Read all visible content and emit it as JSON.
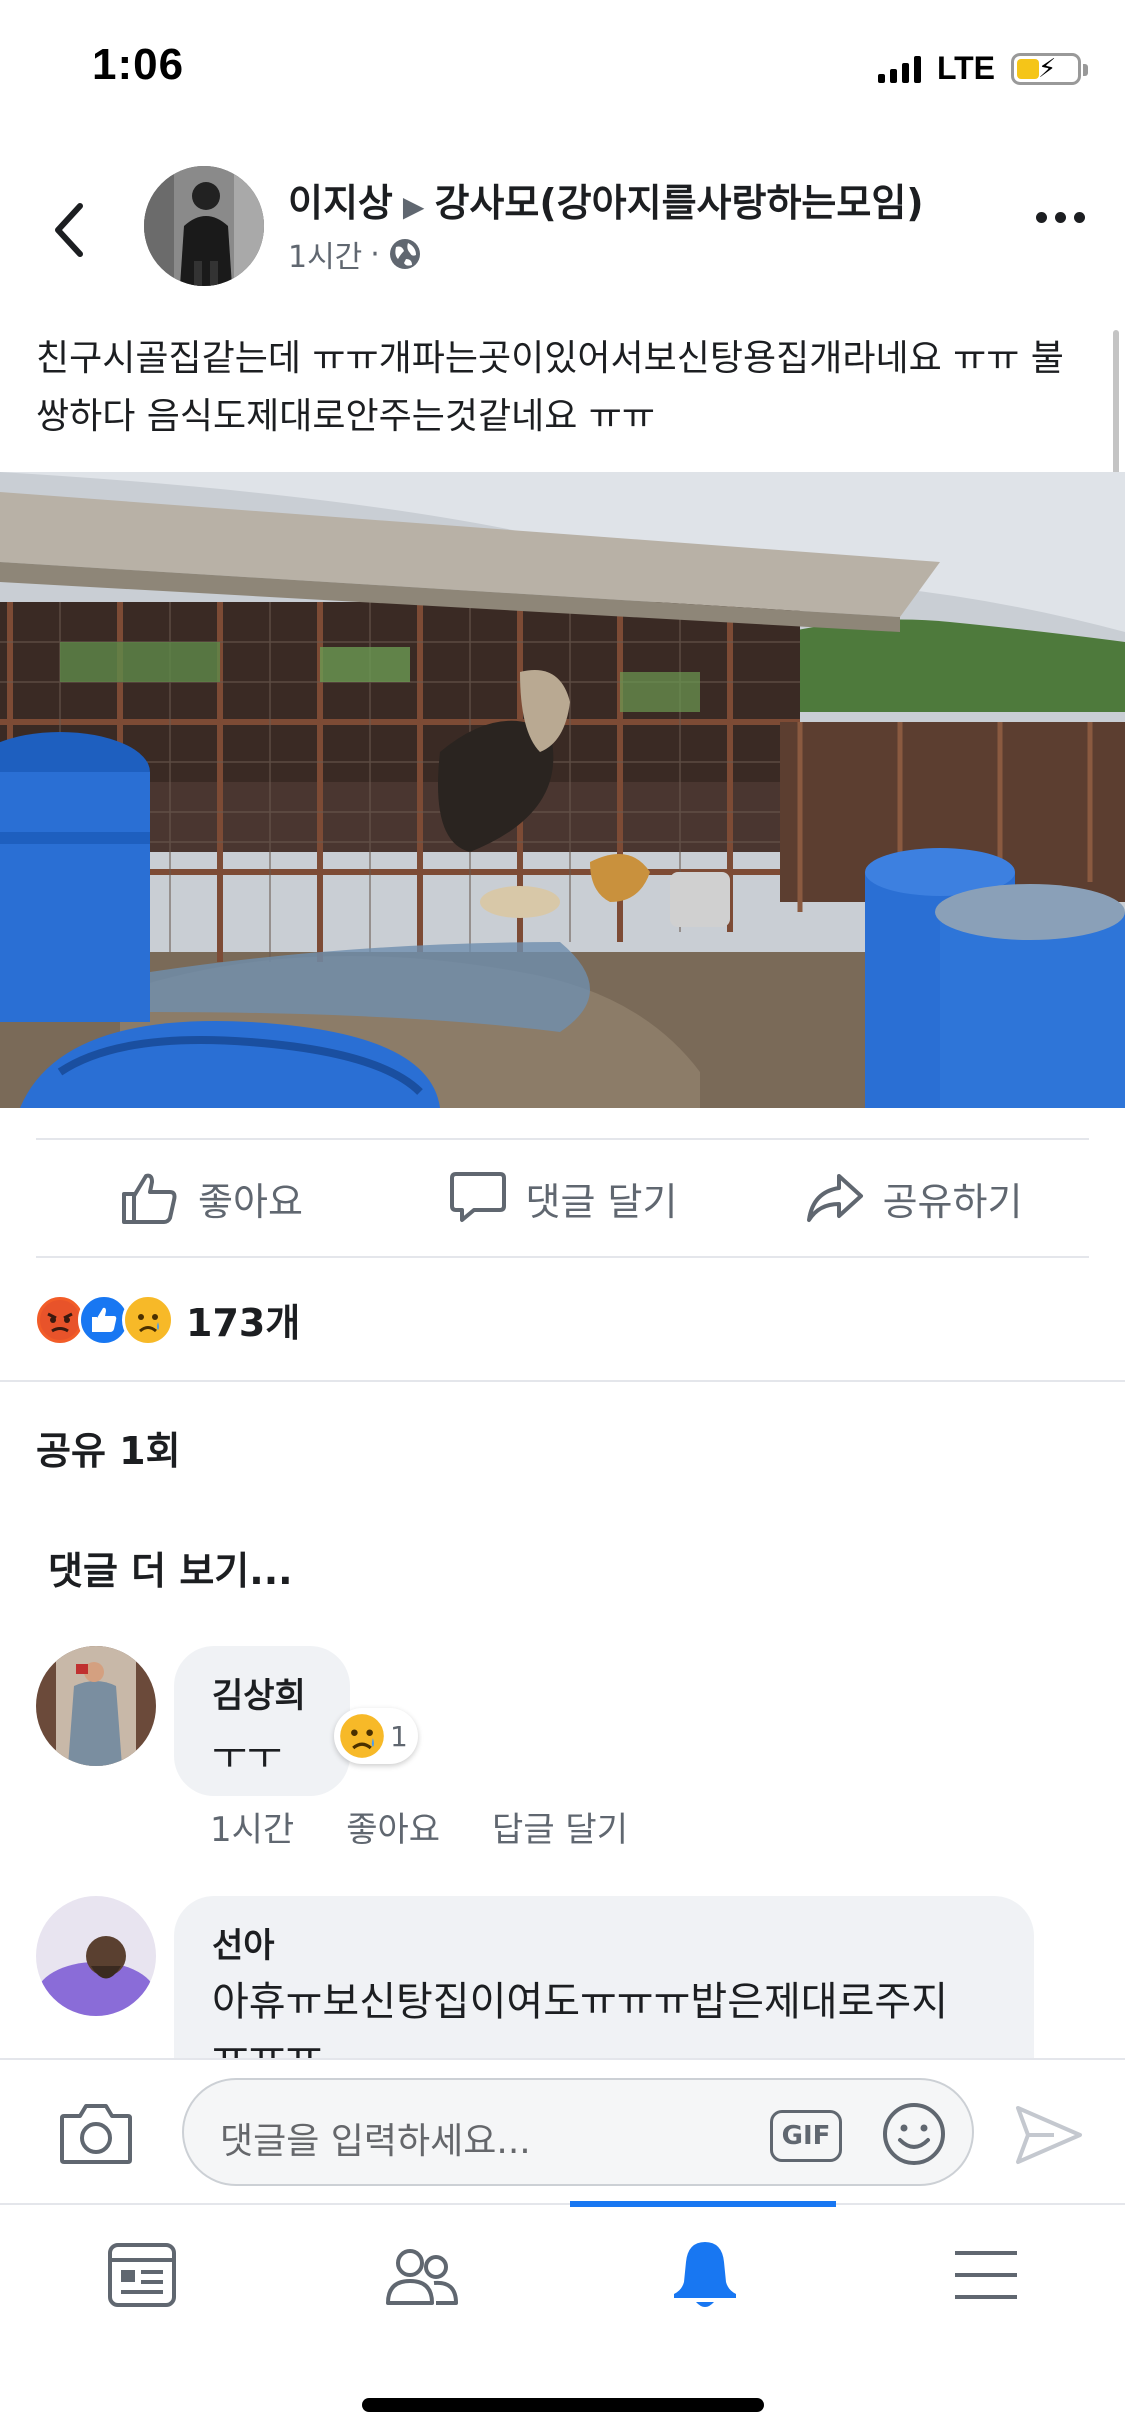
{
  "status_bar": {
    "time": "1:06",
    "network": "LTE"
  },
  "post": {
    "author": "이지상",
    "group": "강사모(강아지를사랑하는모임)",
    "time": "1시간",
    "separator": "·",
    "text": "친구시골집같는데 ㅠㅠ개파는곳이있어서보신탕용집개라네요 ㅠㅠ 불쌍하다 음식도제대로안주는것같네요 ㅠㅠ"
  },
  "actions": {
    "like": "좋아요",
    "comment": "댓글 달기",
    "share": "공유하기"
  },
  "reactions": {
    "count": "173개",
    "icons": [
      "angry-icon",
      "like-icon",
      "sad-icon"
    ]
  },
  "shares": "공유 1회",
  "more_comments": "댓글 더 보기...",
  "comments": [
    {
      "name": "김상희",
      "text": "ㅜㅜ",
      "reaction_count": "1",
      "time": "1시간",
      "like": "좋아요",
      "reply": "답글 달기"
    },
    {
      "name": "선아",
      "text": "아휴ㅠ보신탕집이여도ㅠㅠㅠ밥은제대로주지 ㅠㅠㅠ"
    }
  ],
  "composer": {
    "placeholder": "댓글을 입력하세요...",
    "gif": "GIF"
  },
  "colors": {
    "accent": "#1877f2",
    "text": "#1c1e21",
    "muted": "#606770",
    "bubble": "#f0f2f5"
  }
}
